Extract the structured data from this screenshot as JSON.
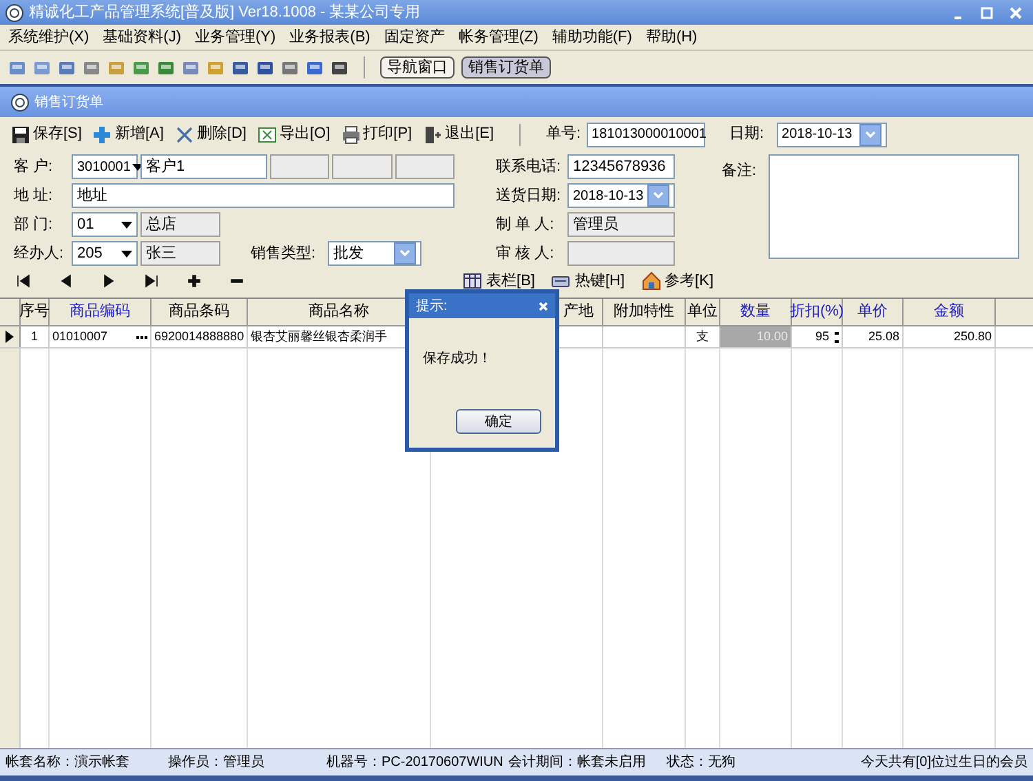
{
  "window": {
    "title": "精诚化工产品管理系统[普及版] Ver18.1008 - 某某公司专用"
  },
  "menu": [
    "系统维护(X)",
    "基础资料(J)",
    "业务管理(Y)",
    "业务报表(B)",
    "固定资产",
    "帐务管理(Z)",
    "辅助功能(F)",
    "帮助(H)"
  ],
  "nav_buttons": [
    {
      "label": "导航窗口",
      "selected": false
    },
    {
      "label": "销售订货单",
      "selected": true
    }
  ],
  "document": {
    "title": "销售订货单"
  },
  "actions": [
    {
      "kind": "save",
      "label": "保存[S]"
    },
    {
      "kind": "add",
      "label": "新增[A]"
    },
    {
      "kind": "delete",
      "label": "删除[D]"
    },
    {
      "kind": "export",
      "label": "导出[O]"
    },
    {
      "kind": "print",
      "label": "打印[P]"
    },
    {
      "kind": "exit",
      "label": "退出[E]"
    }
  ],
  "order_number": {
    "label": "单号:",
    "value": "181013000010001"
  },
  "order_date": {
    "label": "日期:",
    "value": "2018-10-13"
  },
  "form": {
    "customer": {
      "label": "客 户:",
      "code": "3010001",
      "name": "客户1"
    },
    "address": {
      "label": "地 址:",
      "value": "地址"
    },
    "department": {
      "label": "部 门:",
      "code": "01",
      "name": "总店"
    },
    "handler": {
      "label": "经办人:",
      "code": "205",
      "name": "张三"
    },
    "sales_type": {
      "label": "销售类型:",
      "value": "批发"
    },
    "phone": {
      "label": "联系电话:",
      "value": "12345678936"
    },
    "delivery_date": {
      "label": "送货日期:",
      "value": "2018-10-13"
    },
    "creator": {
      "label": "制 单 人:",
      "value": "管理员"
    },
    "reviewer": {
      "label": "审 核 人:"
    },
    "remark": {
      "label": "备注:"
    }
  },
  "grid_tools": [
    {
      "kind": "columns",
      "label": "表栏[B]"
    },
    {
      "kind": "hotkey",
      "label": "热键[H]"
    },
    {
      "kind": "reference",
      "label": "参考[K]"
    }
  ],
  "table": {
    "columns": [
      {
        "label": "序号",
        "emphasized": false
      },
      {
        "label": "商品编码",
        "emphasized": true
      },
      {
        "label": "商品条码",
        "emphasized": false
      },
      {
        "label": "商品名称",
        "emphasized": false
      },
      {
        "label": "产地",
        "emphasized": false
      },
      {
        "label": "附加特性",
        "emphasized": false
      },
      {
        "label": "单位",
        "emphasized": false
      },
      {
        "label": "数量",
        "emphasized": true
      },
      {
        "label": "折扣(%)",
        "emphasized": true
      },
      {
        "label": "单价",
        "emphasized": true
      },
      {
        "label": "金额",
        "emphasized": true
      }
    ],
    "rows": [
      {
        "current": true,
        "cells": [
          "1",
          "01010007",
          "6920014888880",
          "银杏艾丽馨丝银杏柔润手",
          "",
          "",
          "支",
          "10.00",
          "95",
          "25.08",
          "250.80"
        ]
      }
    ]
  },
  "dialog": {
    "title": "提示:",
    "message": "保存成功！",
    "button": "确定"
  },
  "status_bar": [
    "帐套名称：演示帐套",
    "操作员：管理员",
    "机器号：PC-20170607WIUN",
    "会计期间：帐套未启用",
    "状态：无狗",
    "今天共有[0]位过生日的会员"
  ]
}
